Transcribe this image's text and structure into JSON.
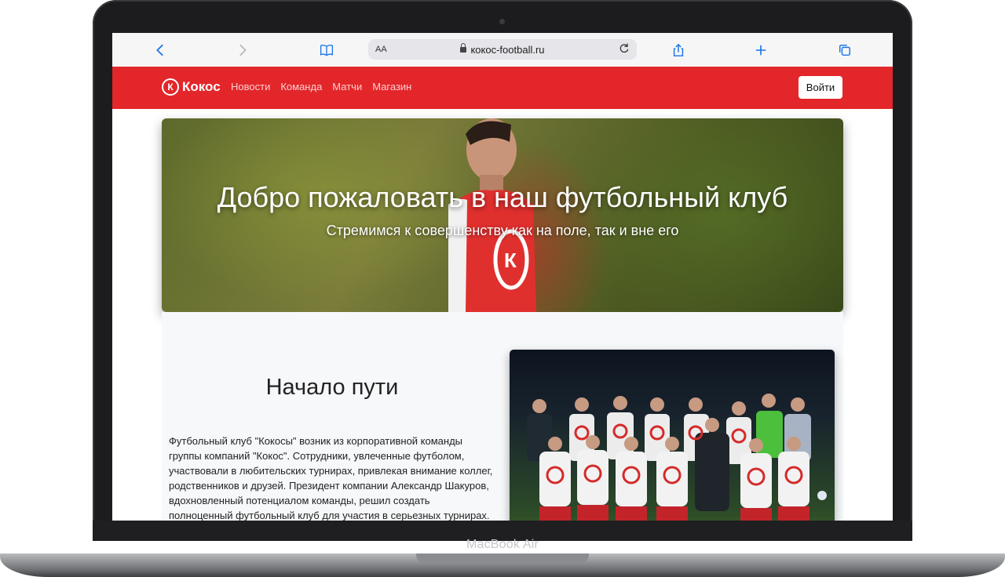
{
  "device": {
    "label": "MacBook Air"
  },
  "browser": {
    "text_size_label": "AA",
    "url": "кокос-football.ru"
  },
  "site": {
    "logo_mark": "К",
    "logo_text": "Кокос",
    "nav_links": [
      "Новости",
      "Команда",
      "Матчи",
      "Магазин"
    ],
    "login_label": "Войти",
    "accent_color": "#e3262a"
  },
  "hero": {
    "title": "Добро пожаловать в наш футбольный клуб",
    "subtitle": "Стремимся к совершенству как на поле, так и вне его"
  },
  "about": {
    "title": "Начало пути",
    "text": "Футбольный клуб \"Кокосы\" возник из корпоративной команды группы компаний \"Кокос\". Сотрудники, увлеченные футболом, участвовали в любительских турнирах, привлекая внимание коллег, родственников и друзей. Президент компании Александр Шакуров, вдохновленный потенциалом команды, решил создать полноценный футбольный клуб для участия в серьезных турнирах."
  }
}
